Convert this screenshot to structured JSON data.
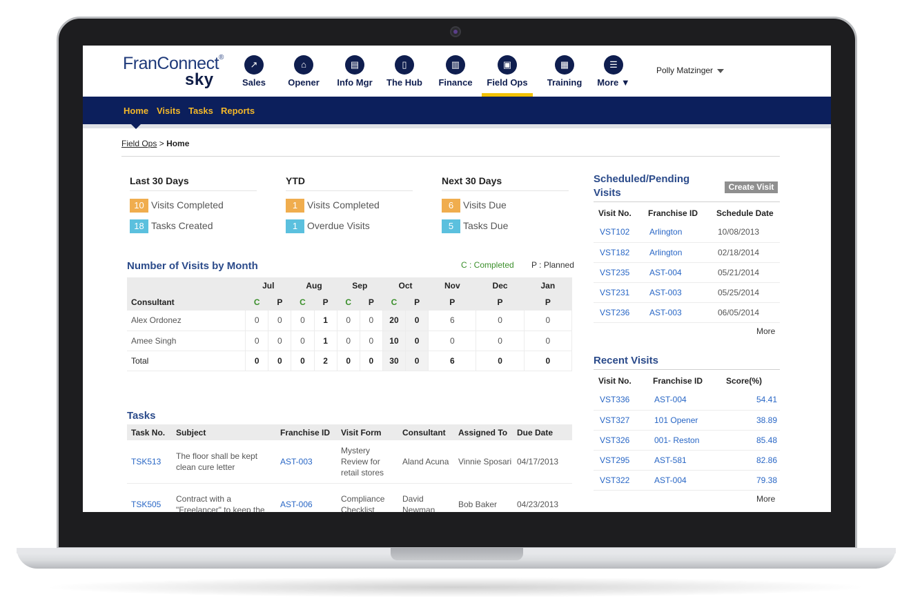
{
  "brand": {
    "name": "FranConnect",
    "trademark": "®",
    "product": "sky"
  },
  "modules": [
    {
      "label": "Sales",
      "icon": "sales-chart-icon",
      "glyph": "↗"
    },
    {
      "label": "Opener",
      "icon": "storefront-icon",
      "glyph": "⌂"
    },
    {
      "label": "Info Mgr",
      "icon": "info-manager-icon",
      "glyph": "▤"
    },
    {
      "label": "The Hub",
      "icon": "hub-document-icon",
      "glyph": "▯"
    },
    {
      "label": "Finance",
      "icon": "finance-chart-icon",
      "glyph": "▥"
    },
    {
      "label": "Field Ops",
      "icon": "field-ops-icon",
      "glyph": "▣"
    },
    {
      "label": "Training",
      "icon": "training-screen-icon",
      "glyph": "▦"
    },
    {
      "label": "More",
      "icon": "menu-icon",
      "glyph": "☰"
    }
  ],
  "user": {
    "name": "Polly Matzinger"
  },
  "subnav": [
    "Home",
    "Visits",
    "Tasks",
    "Reports"
  ],
  "breadcrumb": {
    "parent": "Field Ops",
    "separator": ">",
    "current": "Home"
  },
  "summary": [
    {
      "title": "Last 30 Days",
      "rows": [
        {
          "count": "10",
          "label": "Visits Completed",
          "color": "#f0ad4e"
        },
        {
          "count": "18",
          "label": "Tasks Created",
          "color": "#5bc0de"
        }
      ]
    },
    {
      "title": "YTD",
      "rows": [
        {
          "count": "1",
          "label": "Visits Completed",
          "color": "#f0ad4e"
        },
        {
          "count": "1",
          "label": "Overdue Visits",
          "color": "#5bc0de"
        }
      ]
    },
    {
      "title": "Next 30 Days",
      "rows": [
        {
          "count": "6",
          "label": "Visits Due",
          "color": "#f0ad4e"
        },
        {
          "count": "5",
          "label": "Tasks Due",
          "color": "#5bc0de"
        }
      ]
    }
  ],
  "visits_by_month": {
    "title": "Number of Visits by Month",
    "legend_completed": "C : Completed",
    "legend_planned": "P : Planned",
    "consultant_header": "Consultant",
    "months": [
      "Jul",
      "Aug",
      "Sep",
      "Oct",
      "Nov",
      "Dec",
      "Jan"
    ],
    "sub_c": "C",
    "sub_p": "P",
    "rows": [
      {
        "name": "Alex Ordonez",
        "jul_c": "0",
        "jul_p": "0",
        "aug_c": "0",
        "aug_p": "1",
        "sep_c": "0",
        "sep_p": "0",
        "oct_c": "20",
        "oct_p": "0",
        "nov_p": "6",
        "dec_p": "0",
        "jan_p": "0"
      },
      {
        "name": "Amee Singh",
        "jul_c": "0",
        "jul_p": "0",
        "aug_c": "0",
        "aug_p": "1",
        "sep_c": "0",
        "sep_p": "0",
        "oct_c": "10",
        "oct_p": "0",
        "nov_p": "0",
        "dec_p": "0",
        "jan_p": "0"
      },
      {
        "name": "Total",
        "jul_c": "0",
        "jul_p": "0",
        "aug_c": "0",
        "aug_p": "2",
        "sep_c": "0",
        "sep_p": "0",
        "oct_c": "30",
        "oct_p": "0",
        "nov_p": "6",
        "dec_p": "0",
        "jan_p": "0"
      }
    ]
  },
  "tasks": {
    "title": "Tasks",
    "headers": [
      "Task No.",
      "Subject",
      "Franchise ID",
      "Visit Form",
      "Consultant",
      "Assigned To",
      "Due Date"
    ],
    "rows": [
      {
        "task_no": "TSK513",
        "subject": "The floor shall be kept clean cure letter",
        "franchise_id": "AST-003",
        "visit_form": "Mystery Review for retail stores",
        "consultant": "Aland Acuna",
        "assigned_to": "Vinnie Sposari",
        "due_date": "04/17/2013"
      },
      {
        "task_no": "TSK505",
        "subject": "Contract with a \"Freelancer\" to keep the",
        "franchise_id": "AST-006",
        "visit_form": "Compliance Checklist",
        "consultant": "David Newman",
        "assigned_to": "Bob Baker",
        "due_date": "04/23/2013"
      }
    ]
  },
  "scheduled": {
    "title_line1": "Scheduled/Pending",
    "title_line2": "Visits",
    "create_label": "Create Visit",
    "headers": [
      "Visit No.",
      "Franchise ID",
      "Schedule Date"
    ],
    "rows": [
      {
        "visit_no": "VST102",
        "franchise_id": "Arlington",
        "date": "10/08/2013"
      },
      {
        "visit_no": "VST182",
        "franchise_id": "Arlington",
        "date": "02/18/2014"
      },
      {
        "visit_no": "VST235",
        "franchise_id": "AST-004",
        "date": "05/21/2014"
      },
      {
        "visit_no": "VST231",
        "franchise_id": "AST-003",
        "date": "05/25/2014"
      },
      {
        "visit_no": "VST236",
        "franchise_id": "AST-003",
        "date": "06/05/2014"
      }
    ],
    "more_label": "More"
  },
  "recent": {
    "title": "Recent Visits",
    "headers": [
      "Visit No.",
      "Franchise ID",
      "Score(%)"
    ],
    "rows": [
      {
        "visit_no": "VST336",
        "franchise_id": "AST-004",
        "score": "54.41"
      },
      {
        "visit_no": "VST327",
        "franchise_id": "101 Opener",
        "score": "38.89"
      },
      {
        "visit_no": "VST326",
        "franchise_id": "001- Reston",
        "score": "85.48"
      },
      {
        "visit_no": "VST295",
        "franchise_id": "AST-581",
        "score": "82.86"
      },
      {
        "visit_no": "VST322",
        "franchise_id": "AST-004",
        "score": "79.38"
      }
    ],
    "more_label": "More"
  },
  "colors": {
    "navy": "#0c1f5c",
    "nav_text": "#f4b829",
    "active_underline": "#f2c100",
    "link": "#2866c5",
    "completed_green": "#3a8f2a",
    "title_blue": "#2a4a8a"
  }
}
